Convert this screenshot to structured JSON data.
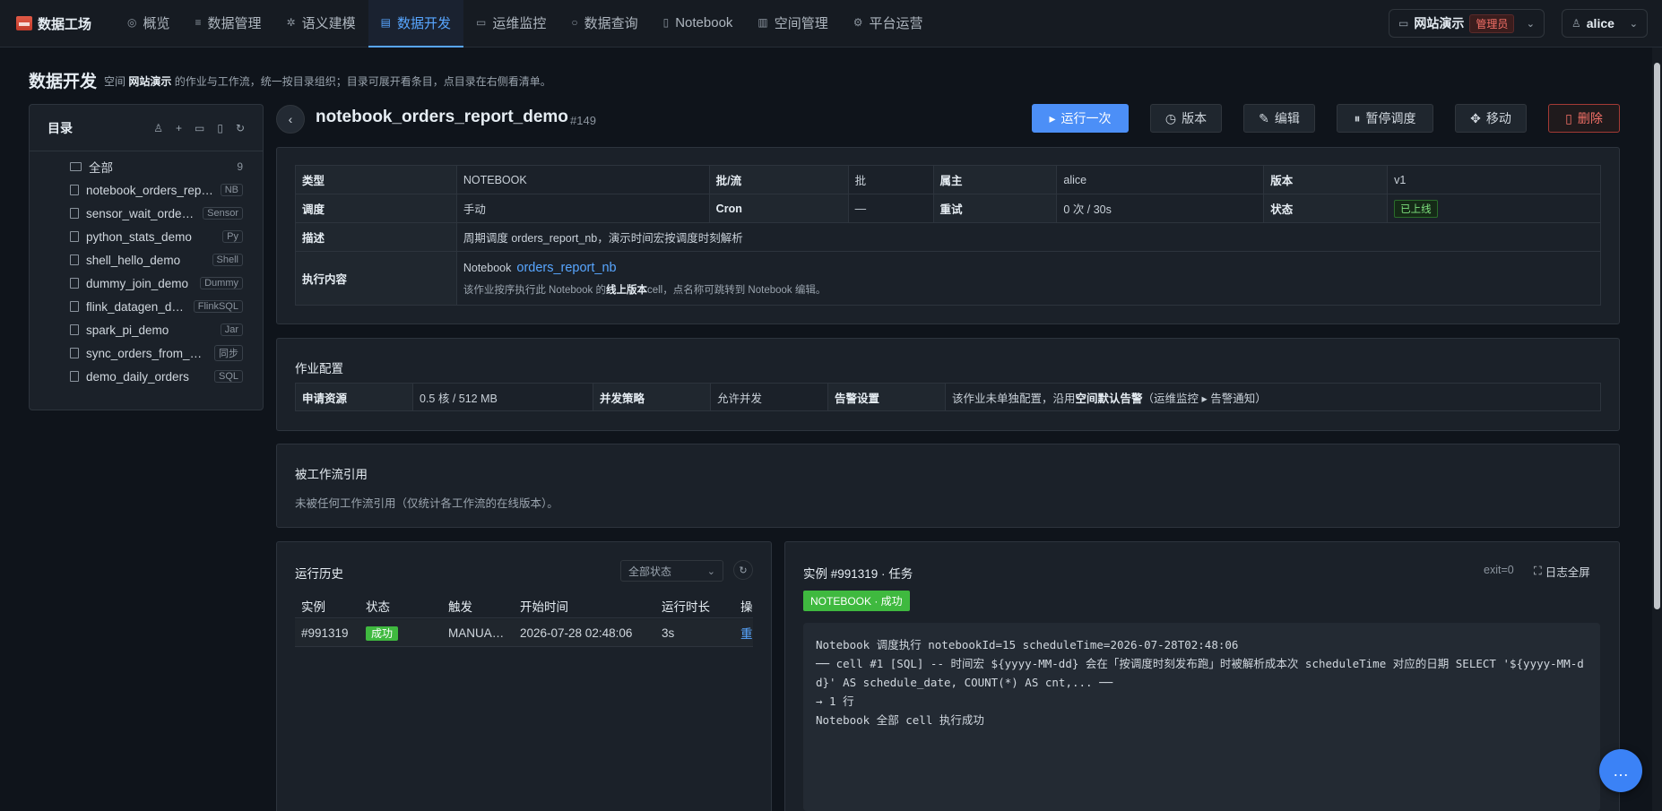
{
  "brand": "数据工场",
  "nav": [
    {
      "label": "概览",
      "icon": "◎"
    },
    {
      "label": "数据管理",
      "icon": "≡"
    },
    {
      "label": "语义建模",
      "icon": "✲"
    },
    {
      "label": "数据开发",
      "icon": "▤"
    },
    {
      "label": "运维监控",
      "icon": "▭"
    },
    {
      "label": "数据查询",
      "icon": "○"
    },
    {
      "label": "Notebook",
      "icon": "▯"
    },
    {
      "label": "空间管理",
      "icon": "▥"
    },
    {
      "label": "平台运营",
      "icon": "⚙"
    }
  ],
  "space": {
    "name": "网站演示",
    "role": "管理员"
  },
  "user": "alice",
  "page": {
    "title": "数据开发",
    "sub_pre": "空间",
    "sub_space": "网站演示",
    "sub_post": "的作业与工作流，统一按目录组织；目录可展开看条目，点目录在右侧看清单。"
  },
  "sidebar": {
    "title": "目录",
    "all_label": "全部",
    "all_count": "9",
    "items": [
      {
        "name": "notebook_orders_report_demo",
        "tag": "NB"
      },
      {
        "name": "sensor_wait_orders_demo",
        "tag": "Sensor"
      },
      {
        "name": "python_stats_demo",
        "tag": "Py"
      },
      {
        "name": "shell_hello_demo",
        "tag": "Shell"
      },
      {
        "name": "dummy_join_demo",
        "tag": "Dummy"
      },
      {
        "name": "flink_datagen_demo",
        "tag": "FlinkSQL"
      },
      {
        "name": "spark_pi_demo",
        "tag": "Jar"
      },
      {
        "name": "sync_orders_from_mysql",
        "tag": "同步"
      },
      {
        "name": "demo_daily_orders",
        "tag": "SQL"
      }
    ]
  },
  "job": {
    "name": "notebook_orders_report_demo",
    "id": "#149",
    "actions": {
      "run": "运行一次",
      "version": "版本",
      "edit": "编辑",
      "pause": "暂停调度",
      "move": "移动",
      "delete": "删除"
    }
  },
  "info": {
    "type_k": "类型",
    "type_v": "NOTEBOOK",
    "batch_k": "批/流",
    "batch_v": "批",
    "owner_k": "属主",
    "owner_v": "alice",
    "ver_k": "版本",
    "ver_v": "v1",
    "sched_k": "调度",
    "sched_v": "手动",
    "cron_k": "Cron",
    "cron_v": "—",
    "retry_k": "重试",
    "retry_v": "0 次 / 30s",
    "status_k": "状态",
    "status_v": "已上线",
    "desc_k": "描述",
    "desc_v": "周期调度 orders_report_nb，演示时间宏按调度时刻解析",
    "exec_k": "执行内容",
    "exec_prefix": "Notebook",
    "exec_link": "orders_report_nb",
    "exec_note_a": "该作业按序执行此 Notebook 的",
    "exec_note_b": "线上版本",
    "exec_note_c": "cell，点名称可跳转到 Notebook 编辑。"
  },
  "config": {
    "title": "作业配置",
    "res_k": "申请资源",
    "res_v": "0.5 核 / 512 MB",
    "conc_k": "并发策略",
    "conc_v": "允许并发",
    "alert_k": "告警设置",
    "alert_a": "该作业未单独配置，沿用",
    "alert_b": "空间默认告警",
    "alert_c": "（运维监控 ▸ 告警通知）"
  },
  "refs": {
    "title": "被工作流引用",
    "note": "未被任何工作流引用（仅统计各工作流的在线版本）。"
  },
  "history": {
    "title": "运行历史",
    "filter": "全部状态",
    "cols": [
      "实例",
      "状态",
      "触发",
      "开始时间",
      "运行时长",
      "操"
    ],
    "rows": [
      {
        "instance": "#991319",
        "status": "成功",
        "trigger": "MANUA…",
        "start": "2026-07-28 02:48:06",
        "duration": "3s",
        "op": "重"
      }
    ]
  },
  "log": {
    "title": "实例 #991319 · 任务",
    "exit": "exit=0",
    "fullscreen": "日志全屏",
    "badge": "NOTEBOOK · 成功",
    "lines": [
      "Notebook 调度执行 notebookId=15 scheduleTime=2026-07-28T02:48:06",
      "── cell #1 [SQL] -- 时间宏 ${yyyy-MM-dd} 会在「按调度时刻发布跑」时被解析成本次 scheduleTime 对应的日期 SELECT '${yyyy-MM-dd}' AS schedule_date, COUNT(*) AS cnt,... ──",
      "→ 1 行",
      "Notebook 全部 cell 执行成功"
    ]
  }
}
